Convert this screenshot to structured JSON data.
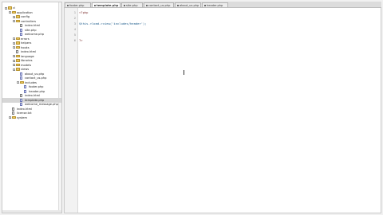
{
  "tabs": [
    {
      "label": "footer.php",
      "active": false
    },
    {
      "label": "template.php",
      "active": true
    },
    {
      "label": "site.php",
      "active": false
    },
    {
      "label": "contact_us.php",
      "active": false
    },
    {
      "label": "about_us.php",
      "active": false
    },
    {
      "label": "header.php",
      "active": false
    }
  ],
  "tree": [
    {
      "label": "ci",
      "type": "folder",
      "expanded": true
    },
    {
      "label": "application",
      "type": "folder",
      "expanded": true
    },
    {
      "label": "config",
      "type": "folder",
      "expanded": false
    },
    {
      "label": "controllers",
      "type": "folder",
      "expanded": true
    },
    {
      "label": "index.html",
      "type": "file"
    },
    {
      "label": "site.php",
      "type": "php"
    },
    {
      "label": "welcome.php",
      "type": "php"
    },
    {
      "label": "errors",
      "type": "folder",
      "expanded": false
    },
    {
      "label": "helpers",
      "type": "folder",
      "expanded": false
    },
    {
      "label": "hooks",
      "type": "folder",
      "expanded": false
    },
    {
      "label": "index.html",
      "type": "file"
    },
    {
      "label": "language",
      "type": "folder",
      "expanded": false
    },
    {
      "label": "libraries",
      "type": "folder",
      "expanded": false
    },
    {
      "label": "models",
      "type": "folder",
      "expanded": false
    },
    {
      "label": "views",
      "type": "folder",
      "expanded": true
    },
    {
      "label": "about_us.php",
      "type": "php"
    },
    {
      "label": "contact_us.php",
      "type": "php"
    },
    {
      "label": "includes",
      "type": "folder",
      "expanded": true
    },
    {
      "label": "footer.php",
      "type": "php"
    },
    {
      "label": "header.php",
      "type": "php"
    },
    {
      "label": "index.html",
      "type": "file"
    },
    {
      "label": "template.php",
      "type": "php",
      "selected": true
    },
    {
      "label": "welcome_message.php",
      "type": "php"
    },
    {
      "label": "index.html",
      "type": "file"
    },
    {
      "label": "license.txt",
      "type": "file"
    },
    {
      "label": "system",
      "type": "folder",
      "expanded": false
    }
  ],
  "editor": {
    "lines": [
      {
        "num": "1",
        "text": "<?php"
      },
      {
        "num": "2",
        "text": ""
      },
      {
        "num": "3",
        "text": "$this->load->view('includes/header');"
      },
      {
        "num": "4",
        "text": ""
      },
      {
        "num": "5",
        "text": ""
      },
      {
        "num": "6",
        "text": "?>"
      }
    ]
  },
  "colors": {
    "accent_folder": "#e7c35a",
    "selected_row": "#d6d6d6",
    "editor_bg": "#ffffff"
  }
}
